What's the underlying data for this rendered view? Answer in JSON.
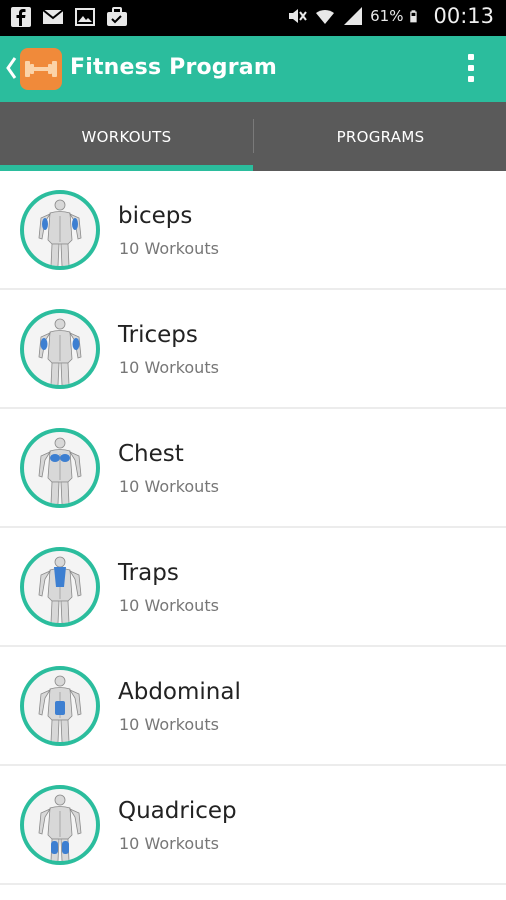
{
  "status_bar": {
    "battery_percent": "61%",
    "time": "00:13",
    "left_icons": [
      "facebook-icon",
      "mail-icon",
      "image-icon",
      "briefcase-icon"
    ],
    "right_icons": [
      "mute-icon",
      "wifi-icon",
      "signal-icon",
      "battery-icon"
    ]
  },
  "action_bar": {
    "title": "Fitness Program",
    "background_color": "#2bbd9d",
    "logo_color": "#f08a3a"
  },
  "tabs": [
    {
      "label": "WORKOUTS",
      "selected": true
    },
    {
      "label": "PROGRAMS",
      "selected": false
    }
  ],
  "workouts": [
    {
      "name": "biceps",
      "count": "10 Workouts",
      "highlight": "biceps"
    },
    {
      "name": "Triceps",
      "count": "10 Workouts",
      "highlight": "triceps"
    },
    {
      "name": "Chest",
      "count": "10 Workouts",
      "highlight": "chest"
    },
    {
      "name": "Traps",
      "count": "10 Workouts",
      "highlight": "traps"
    },
    {
      "name": "Abdominal",
      "count": "10 Workouts",
      "highlight": "abs"
    },
    {
      "name": "Quadricep",
      "count": "10 Workouts",
      "highlight": "quads"
    }
  ],
  "accent_color": "#2bbd9d",
  "muscle_highlight_color": "#3d7fd1"
}
